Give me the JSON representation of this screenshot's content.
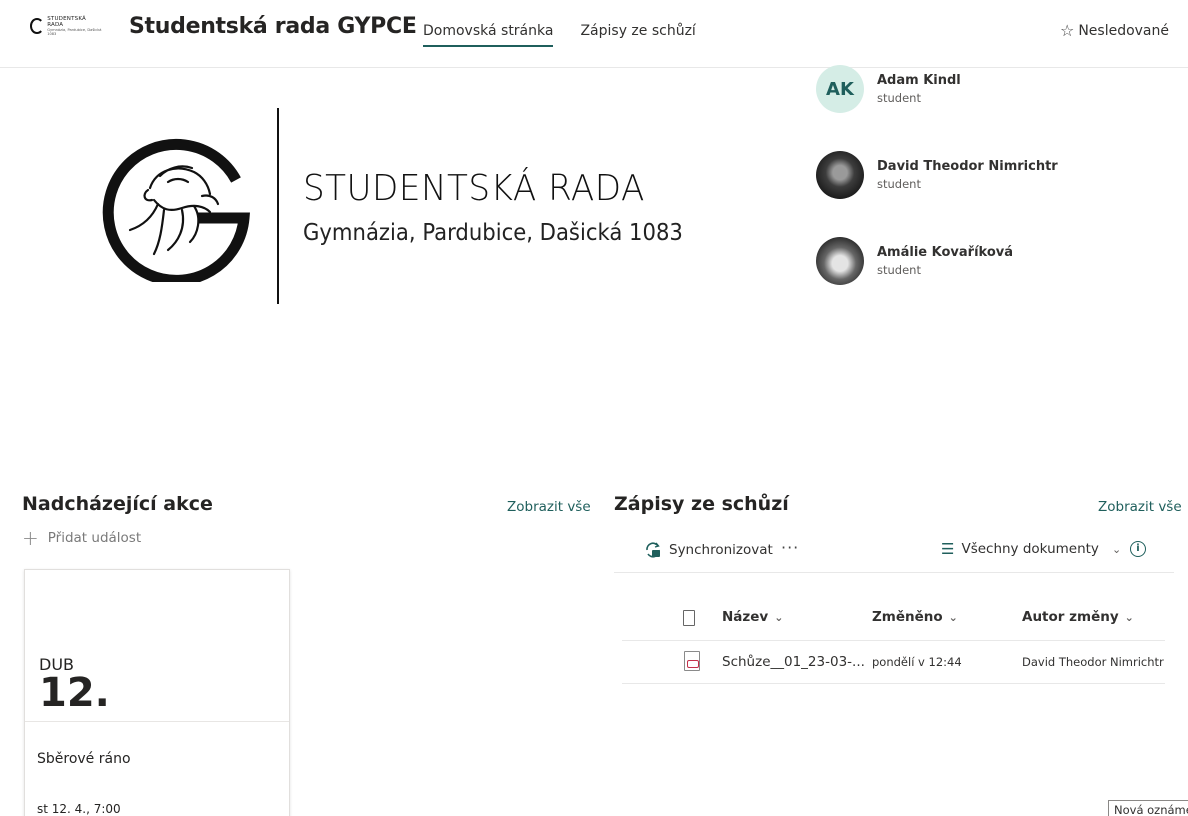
{
  "header": {
    "logo_line1": "STUDENTSKÁ RADA",
    "logo_line2": "Gymnázia, Pardubice, Dašická 1083",
    "site_title": "Studentská rada GYPCE",
    "nav": [
      {
        "label": "Domovská stránka",
        "active": true
      },
      {
        "label": "Zápisy ze schůzí",
        "active": false
      }
    ],
    "follow_label": "Nesledované",
    "follow_icon": "star-outline-icon"
  },
  "hero": {
    "title": "STUDENTSKÁ RADA",
    "subtitle": "Gymnázia, Pardubice, Dašická 1083"
  },
  "people": [
    {
      "name": "Adam Kindl",
      "role": "student",
      "initials": "AK"
    },
    {
      "name": "David Theodor Nimrichtr",
      "role": "student",
      "initials": ""
    },
    {
      "name": "Amálie Kovaříková",
      "role": "student",
      "initials": ""
    }
  ],
  "events": {
    "title": "Nadcházející akce",
    "see_all": "Zobrazit vše",
    "add_label": "Přidat událost",
    "items": [
      {
        "month": "DUB",
        "day": "12.",
        "title": "Sběrové ráno",
        "time": "st 12. 4., 7:00"
      }
    ]
  },
  "documents": {
    "title": "Zápisy ze schůzí",
    "see_all": "Zobrazit vše",
    "sync_label": "Synchronizovat",
    "more_label": "···",
    "view_label": "Všechny dokumenty",
    "info_label": "i",
    "columns": {
      "name": "Název",
      "modified": "Změněno",
      "modified_by": "Autor změny"
    },
    "rows": [
      {
        "name": "Schůze__01_23-03-...",
        "modified": "pondělí v 12:44",
        "modified_by": "David Theodor Nimrichtr"
      }
    ]
  },
  "toast": "Nová oznámení",
  "colors": {
    "accent": "#1f5f5c",
    "avatar_bg": "#d5ede6",
    "pdf": "#c4314b"
  }
}
